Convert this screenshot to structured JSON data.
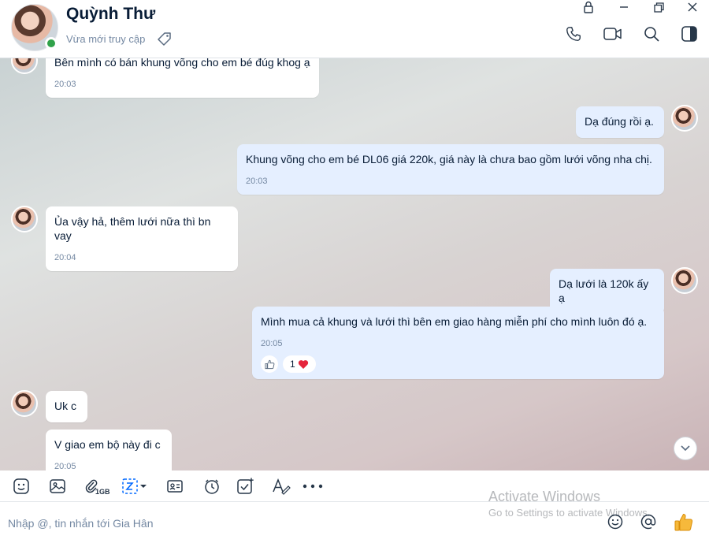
{
  "header": {
    "contact_name": "Quỳnh Thư",
    "status": "Vừa mới truy cập"
  },
  "icons": {
    "tag": "tag-icon",
    "lock": "lock-icon",
    "minimize": "minimize-icon",
    "restore": "restore-icon",
    "close": "close-icon",
    "call": "phone-icon",
    "video": "video-icon",
    "search": "search-icon",
    "panel": "panel-toggle-icon"
  },
  "messages": [
    {
      "side": "in",
      "text": "Bên mình có bán khung võng cho em bé đúg khog ạ",
      "time": "20:03"
    },
    {
      "side": "out",
      "text": "Dạ đúng rồi ạ."
    },
    {
      "side": "out",
      "text": "Khung võng cho em bé DL06 giá 220k, giá này là chưa bao gồm lưới võng nha chị.",
      "time": "20:03"
    },
    {
      "side": "in",
      "text": "Ủa vậy hả, thêm lưới nữa thì bn vay",
      "time": "20:04"
    },
    {
      "side": "out",
      "text": "Dạ lưới là 120k ấy ạ"
    },
    {
      "side": "out",
      "text": "Mình mua cả khung và lưới thì bên em giao hàng miễn phí cho mình luôn đó ạ.",
      "time": "20:05",
      "reaction_count": "1"
    },
    {
      "side": "in",
      "text": "Uk c"
    },
    {
      "side": "in",
      "text": "V giao em bộ này đi c",
      "time": "20:05"
    }
  ],
  "toolbar": {
    "attachment_quota": "1GB"
  },
  "input": {
    "placeholder": "Nhập @, tin nhắn tới Gia Hân"
  },
  "watermark": {
    "title": "Activate Windows",
    "subtitle": "Go to Settings to activate Windows."
  },
  "colors": {
    "online": "#30a24a",
    "incoming_bubble": "#ffffff",
    "outgoing_bubble": "#e5efff",
    "heart": "#e5243b",
    "like": "#f6b93b"
  }
}
